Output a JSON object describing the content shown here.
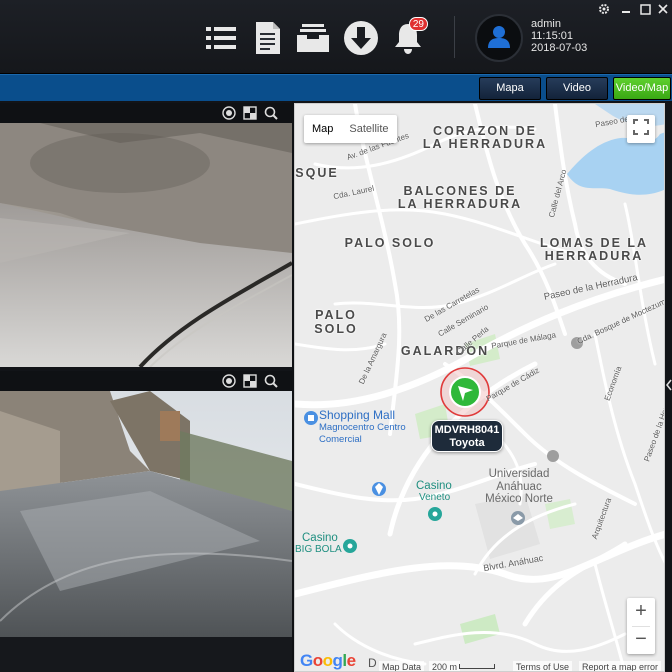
{
  "header": {
    "notification_count": "29",
    "user": {
      "name": "admin",
      "time": "11:15:01",
      "date": "2018-07-03"
    },
    "icons": [
      "list-icon",
      "document-icon",
      "inbox-icon",
      "download-icon",
      "bell-icon",
      "avatar-icon",
      "gear-icon",
      "minimize-icon",
      "maximize-icon",
      "close-icon"
    ]
  },
  "tabs": [
    {
      "label": "Mapa"
    },
    {
      "label": "Video"
    },
    {
      "label": "Video/Map",
      "active": true
    }
  ],
  "map": {
    "type_buttons": [
      "Map",
      "Satellite"
    ],
    "neighborhoods": [
      "CORAZON DE",
      "LA HERRADURA",
      "BALCONES DE",
      "LA HERRADURA",
      "PALO SOLO",
      "LOMAS DE LA",
      "HERRADURA",
      "PALO SOLO",
      "GALARDON",
      "SQUE"
    ],
    "streets": [
      "Paseo de la Herradura",
      "Paseo de la Herradura",
      "Calle del Arco",
      "Cda. Laurel",
      "Av. de las Fuentes",
      "Parque de Málaga",
      "Parque de Cádiz",
      "Blvrd. Anáhuac",
      "De las Carretelas",
      "Calle Seminario",
      "Calle Perla",
      "Paseo de la...",
      "Cda. Bosque de Moctezuma",
      "De la Amargura",
      "Arquitectura",
      "Economía"
    ],
    "places": [
      {
        "name": "Shopping Mall",
        "sub": "Magnocentro Centro Comercial"
      },
      {
        "name": "Casino",
        "sub": "Veneto"
      },
      {
        "name": "Casino",
        "sub": "BIG BOLA"
      },
      {
        "name": "Universidad Anáhuac México Norte",
        "sub": ""
      }
    ],
    "vehicle": {
      "id": "MDVRH8041",
      "name": "Toyota"
    },
    "zoom_in": "+",
    "zoom_out": "−",
    "footer": {
      "logo": "Google",
      "logo_colors": [
        "#4285F4",
        "#EA4335",
        "#FBBC05",
        "#4285F4",
        "#34A853",
        "#EA4335"
      ],
      "map_data": "Map Data",
      "scale": "200 m",
      "terms": "Terms of Use",
      "report": "Report a map error",
      "partial": "D"
    }
  },
  "colors": {
    "tab_active": "#4cbc20",
    "tabbar": "#0a4e8c",
    "vehicle_marker": "#2fb83a",
    "marker_ring": "#e03a3a"
  }
}
